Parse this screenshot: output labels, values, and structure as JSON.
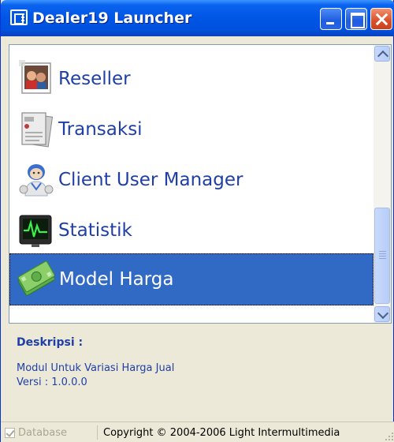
{
  "window": {
    "title": "Dealer19 Launcher"
  },
  "list": {
    "items": [
      {
        "label": "Reseller",
        "icon": "reseller-photo-icon",
        "selected": false
      },
      {
        "label": "Transaksi",
        "icon": "transaksi-document-icon",
        "selected": false
      },
      {
        "label": "Client User Manager",
        "icon": "client-user-icon",
        "selected": false
      },
      {
        "label": "Statistik",
        "icon": "statistik-monitor-icon",
        "selected": false
      },
      {
        "label": "Model Harga",
        "icon": "money-icon",
        "selected": true
      }
    ]
  },
  "description": {
    "title": "Deskripsi :",
    "line1": "Modul Untuk Variasi Harga Jual",
    "line2": "Versi : 1.0.0.0"
  },
  "statusbar": {
    "database_label": "Database",
    "copyright": "Copyright © 2004-2006 Light Intermultimedia"
  },
  "colors": {
    "titlebar": "#0055E5",
    "selection": "#316AC5",
    "link_text": "#1F3FA6",
    "window_bg": "#ECE9D8"
  }
}
